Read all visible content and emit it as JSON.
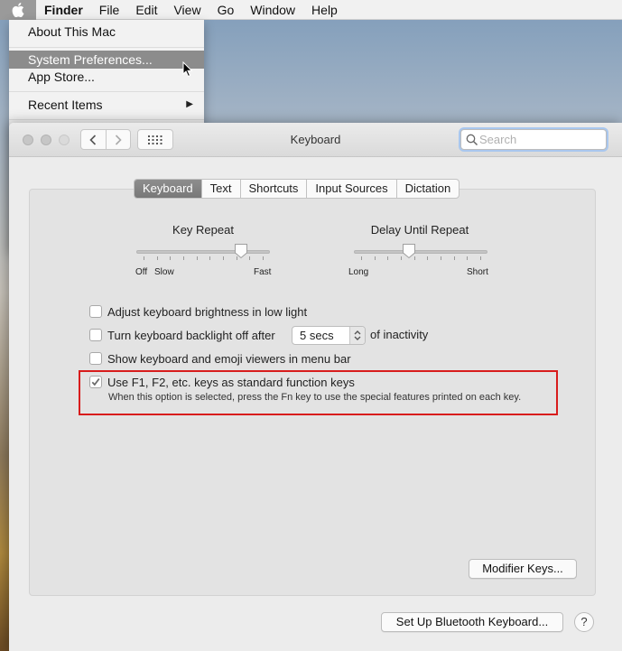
{
  "menubar": {
    "apple_icon": "apple-logo-icon",
    "items": [
      "Finder",
      "File",
      "Edit",
      "View",
      "Go",
      "Window",
      "Help"
    ]
  },
  "apple_menu": {
    "about": "About This Mac",
    "system_preferences": "System Preferences...",
    "app_store": "App Store...",
    "recent_items": "Recent Items"
  },
  "window": {
    "title": "Keyboard",
    "search_placeholder": "Search"
  },
  "tabs": [
    "Keyboard",
    "Text",
    "Shortcuts",
    "Input Sources",
    "Dictation"
  ],
  "active_tab": "Keyboard",
  "key_repeat": {
    "title": "Key Repeat",
    "label_off": "Off",
    "label_slow": "Slow",
    "label_fast": "Fast",
    "level": 0.82
  },
  "delay_until_repeat": {
    "title": "Delay Until Repeat",
    "label_long": "Long",
    "label_short": "Short",
    "level": 0.4
  },
  "options": {
    "adjust_brightness": "Adjust keyboard brightness in low light",
    "backlight_off": "Turn keyboard backlight off after",
    "backlight_value": "5 secs",
    "inactivity": "of inactivity",
    "show_viewers": "Show keyboard and emoji viewers in menu bar",
    "use_fn_keys": "Use F1, F2, etc. keys as standard function keys",
    "fn_note": "When this option is selected, press the Fn key to use the special features printed on each key."
  },
  "buttons": {
    "modifier_keys": "Modifier Keys...",
    "bluetooth": "Set Up Bluetooth Keyboard...",
    "help": "?"
  },
  "colors": {
    "highlight_box": "#d81c1c"
  }
}
